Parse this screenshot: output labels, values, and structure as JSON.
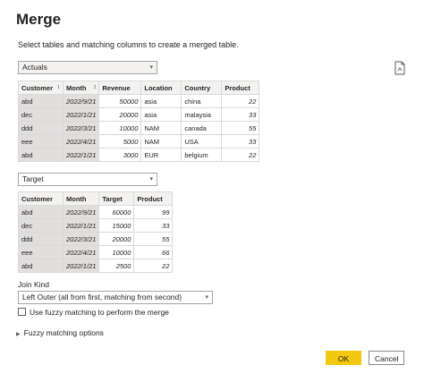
{
  "dialog": {
    "title": "Merge",
    "subtitle": "Select tables and matching columns to create a merged table."
  },
  "table1": {
    "selected": "Actuals",
    "headers": [
      "Customer",
      "Month",
      "Revenue",
      "Location",
      "Country",
      "Product"
    ],
    "sort_badges": [
      "1",
      "2"
    ],
    "rows": [
      [
        "abd",
        "2022/9/21",
        "50000",
        "asia",
        "china",
        "22"
      ],
      [
        "dec",
        "2022/1/21",
        "20000",
        "asia",
        "malaysia",
        "33"
      ],
      [
        "ddd",
        "2022/3/21",
        "10000",
        "NAM",
        "canada",
        "55"
      ],
      [
        "eee",
        "2022/4/21",
        "5000",
        "NAM",
        "USA",
        "33"
      ],
      [
        "abd",
        "2022/1/21",
        "3000",
        "EUR",
        "belgium",
        "22"
      ]
    ]
  },
  "table2": {
    "selected": "Target",
    "headers": [
      "Customer",
      "Month",
      "Target",
      "Product"
    ],
    "rows": [
      [
        "abd",
        "2022/9/21",
        "60000",
        "99"
      ],
      [
        "dec",
        "2022/1/21",
        "15000",
        "33"
      ],
      [
        "ddd",
        "2022/3/21",
        "20000",
        "55"
      ],
      [
        "eee",
        "2022/4/21",
        "10000",
        "66"
      ],
      [
        "abd",
        "2022/1/21",
        "2500",
        "22"
      ]
    ]
  },
  "join": {
    "label": "Join Kind",
    "selected": "Left Outer (all from first, matching from second)"
  },
  "fuzzy": {
    "checkbox_label": "Use fuzzy matching to perform the merge",
    "checked": false,
    "options_label": "Fuzzy matching options"
  },
  "buttons": {
    "ok": "OK",
    "cancel": "Cancel"
  },
  "colors": {
    "ok_button": "#f2c811",
    "selected_column": "#e1dfdd",
    "header_bg": "#f3f2f1"
  }
}
